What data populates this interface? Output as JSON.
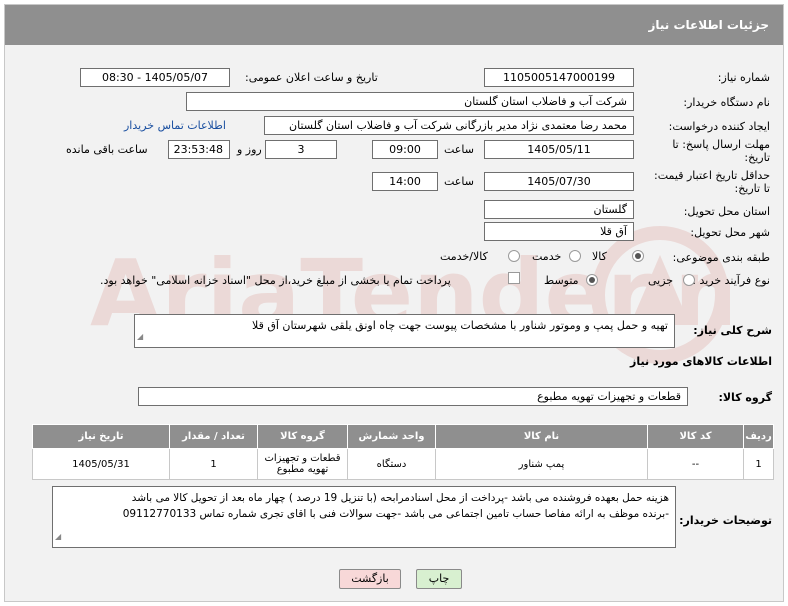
{
  "header": {
    "title": "جزئیات اطلاعات نیاز"
  },
  "fields": {
    "need_number_label": "شماره نیاز:",
    "need_number": "1105005147000199",
    "announce_label": "تاریخ و ساعت اعلان عمومی:",
    "announce_value": "1405/05/07 - 08:30",
    "buyer_org_label": "نام دستگاه خریدار:",
    "buyer_org": "شرکت آب و فاضلاب استان گلستان",
    "creator_label": "ایجاد کننده درخواست:",
    "creator": "محمد رضا معتمدی نژاد مدیر بازرگانی شرکت آب و فاضلاب استان گلستان",
    "buyer_contact_link": "اطلاعات تماس خریدار",
    "reply_deadline_label_1": "مهلت ارسال پاسخ: تا",
    "reply_deadline_label_2": "تاریخ:",
    "reply_date": "1405/05/11",
    "time_label": "ساعت",
    "reply_time": "09:00",
    "reply_days": "3",
    "days_label": "روز و",
    "remaining_time": "23:53:48",
    "remaining_label": "ساعت باقی مانده",
    "price_validity_label_1": "حداقل تاریخ اعتبار قیمت:",
    "price_validity_label_2": "تا تاریخ:",
    "validity_date": "1405/07/30",
    "validity_time": "14:00",
    "province_label": "استان محل تحویل:",
    "province": "گلستان",
    "city_label": "شهر محل تحویل:",
    "city": "آق قلا",
    "category_label": "طبقه بندی موضوعی:",
    "category_options": [
      "کالا",
      "خدمت",
      "کالا/خدمت"
    ],
    "process_label": "نوع فرآیند خرید :",
    "process_options": [
      "جزیی",
      "متوسط"
    ],
    "payment_note": "پرداخت تمام یا بخشی از مبلغ خرید،از محل \"اسناد خزانه اسلامی\" خواهد بود."
  },
  "description": {
    "label": "شرح کلی نیاز:",
    "text": "تهیه و حمل پمپ و وموتور شناور با مشخصات پیوست جهت چاه اونق یلقی شهرستان آق قلا"
  },
  "goods_info_title": "اطلاعات کالاهای مورد نیاز",
  "goods_group": {
    "label": "گروه کالا:",
    "value": "قطعات و تجهیزات تهویه مطبوع"
  },
  "table": {
    "headers": [
      "ردیف",
      "کد کالا",
      "نام کالا",
      "واحد شمارش",
      "گروه کالا",
      "تعداد / مقدار",
      "تاریخ نیاز"
    ],
    "rows": [
      [
        "1",
        "--",
        "پمپ شناور",
        "دستگاه",
        "قطعات و تجهیزات تهویه مطبوع",
        "1",
        "1405/05/31"
      ]
    ]
  },
  "buyer_notes": {
    "label": "توضیحات خریدار:",
    "line1": "هزینه حمل بعهده فروشنده می باشد -پرداخت از محل اسنادمرابحه (با تنزیل 19 درصد ) چهار ماه بعد از تحویل کالا می باشد",
    "line2": "-برنده موظف به ارائه مفاصا حساب تامین اجتماعی می باشد -جهت سوالات فنی با اقای تجری شماره تماس 09112770133"
  },
  "buttons": {
    "print": "چاپ",
    "back": "بازگشت"
  },
  "colors": {
    "header_bg": "#8f8f8f",
    "link": "#1a4fa0",
    "print_btn": "#d8f0d0",
    "back_btn": "#f8d8d8",
    "watermark": "#c0392b"
  }
}
